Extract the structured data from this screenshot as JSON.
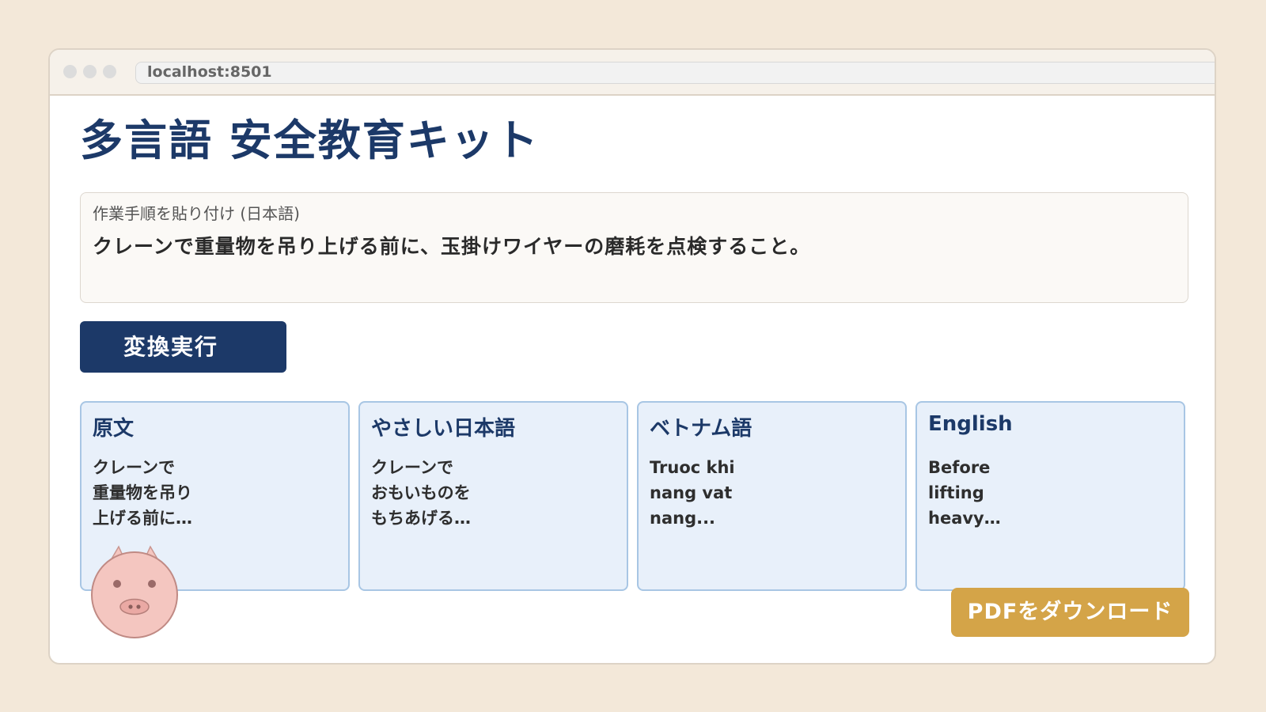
{
  "browser": {
    "address": "localhost:8501"
  },
  "page": {
    "title": "多言語 安全教育キット"
  },
  "input": {
    "label": "作業手順を貼り付け (日本語)",
    "value": "クレーンで重量物を吊り上げる前に、玉掛けワイヤーの磨耗を点検すること。"
  },
  "actions": {
    "convert_label": "変換実行",
    "pdf_label": "PDFをダウンロード"
  },
  "cards": [
    {
      "title": "原文",
      "lines": [
        "クレーンで",
        "重量物を吊り",
        "上げる前に…"
      ]
    },
    {
      "title": "やさしい日本語",
      "lines": [
        "クレーンで",
        "おもいものを",
        "もちあげる…"
      ]
    },
    {
      "title": "ベトナム語",
      "lines": [
        "Truoc khi",
        "nang vat",
        "nang..."
      ]
    },
    {
      "title": "English",
      "lines": [
        "Before",
        "lifting",
        "heavy…"
      ]
    }
  ],
  "colors": {
    "background": "#f3e8d9",
    "primary": "#1c3968",
    "card_bg": "#e8f0fa",
    "card_border": "#a8c6e4",
    "download": "#d4a448",
    "mascot": "#f4c6c0"
  },
  "icons": {
    "mascot": "pig-mascot-icon"
  }
}
